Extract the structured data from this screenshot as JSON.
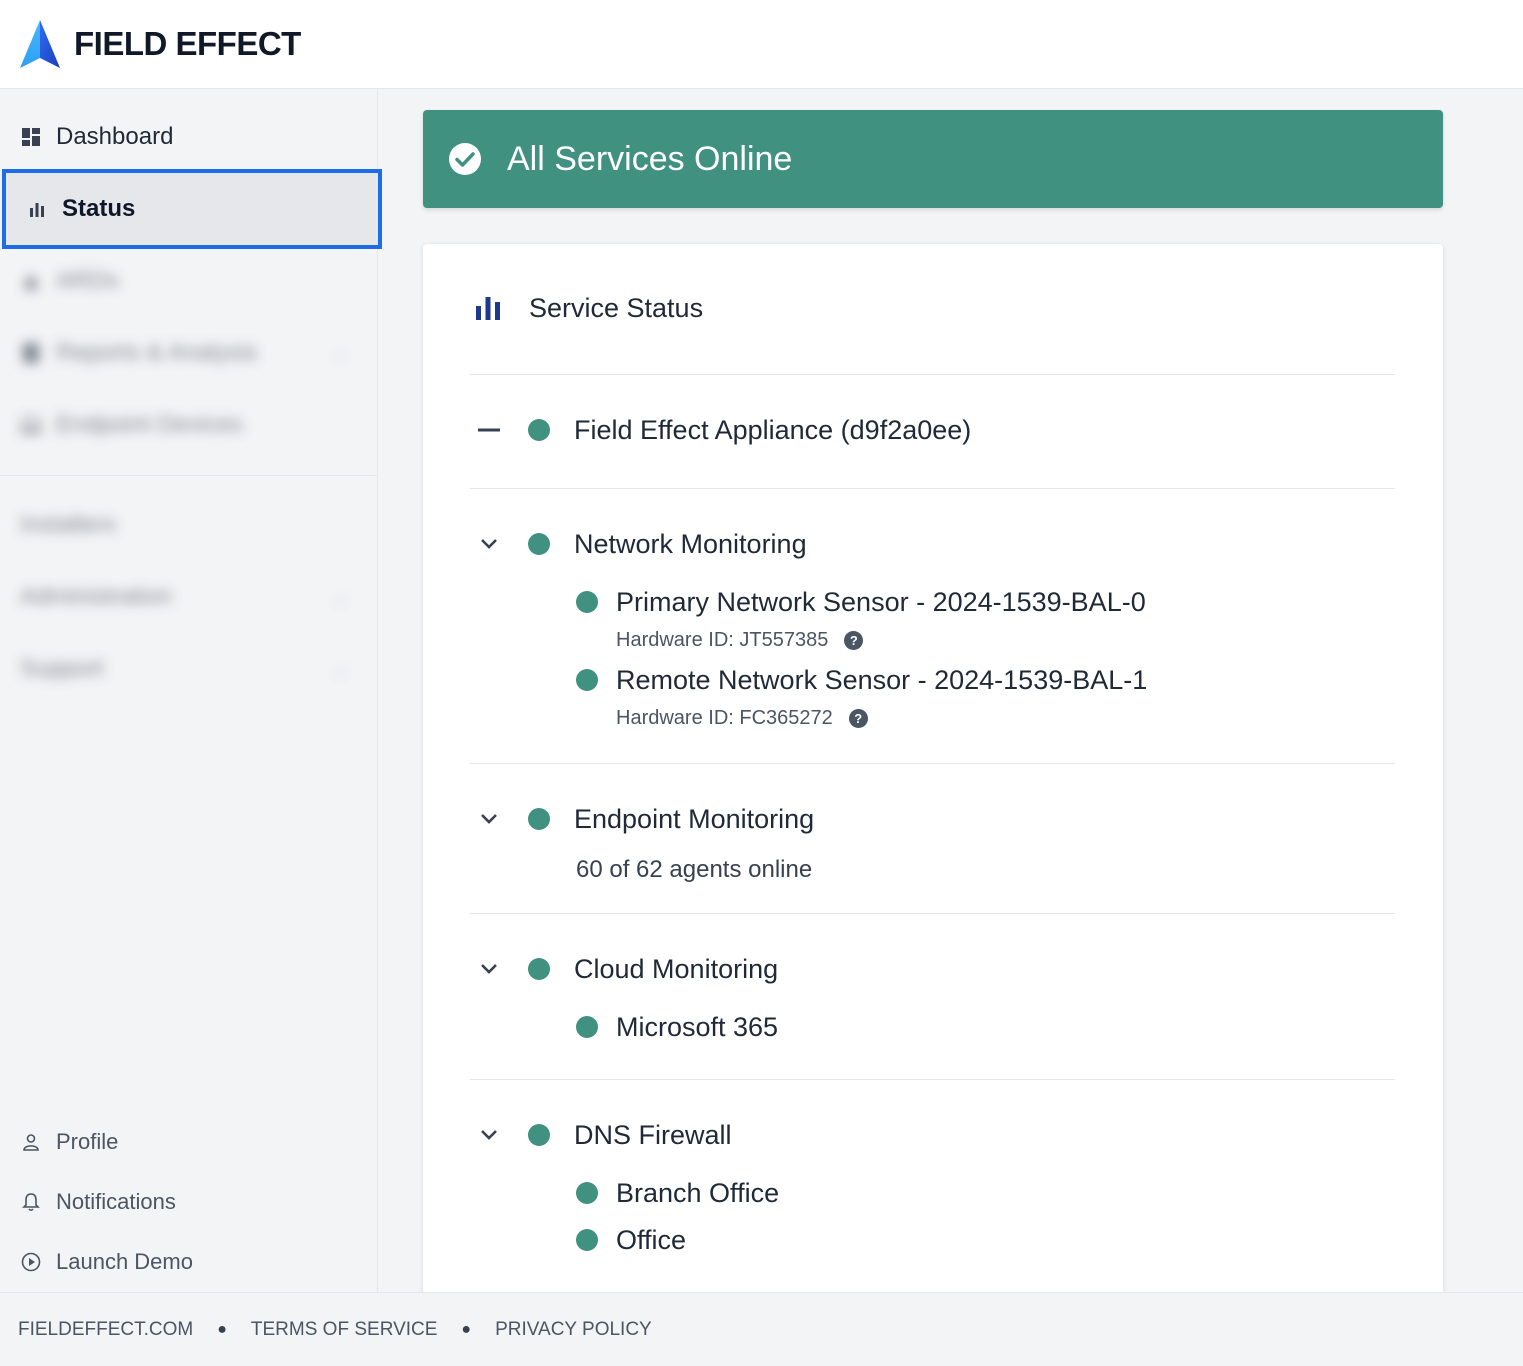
{
  "brand": {
    "name": "FIELD EFFECT"
  },
  "sidebar": {
    "items": [
      {
        "label": "Dashboard",
        "icon": "dashboard-grid-icon"
      },
      {
        "label": "Status",
        "icon": "bar-chart-icon",
        "active": true
      },
      {
        "label": "ARDs",
        "icon": "alert-icon"
      },
      {
        "label": "Reports & Analysis",
        "icon": "report-icon"
      },
      {
        "label": "Endpoint Devices",
        "icon": "laptop-icon"
      },
      {
        "label": "Installers"
      },
      {
        "label": "Administration"
      },
      {
        "label": "Support"
      }
    ],
    "bottom": [
      {
        "label": "Profile",
        "icon": "user-icon"
      },
      {
        "label": "Notifications",
        "icon": "bell-icon"
      },
      {
        "label": "Launch Demo",
        "icon": "play-circle-icon"
      }
    ]
  },
  "banner": {
    "text": "All Services Online",
    "color": "#419180"
  },
  "service_status": {
    "title": "Service Status",
    "services": [
      {
        "label": "Field Effect Appliance (d9f2a0ee)",
        "status": "online"
      },
      {
        "label": "Network Monitoring",
        "status": "online",
        "children": [
          {
            "label": "Primary Network Sensor - 2024-1539-BAL-0",
            "hardware_id": "Hardware ID: JT557385"
          },
          {
            "label": "Remote Network Sensor - 2024-1539-BAL-1",
            "hardware_id": "Hardware ID: FC365272"
          }
        ]
      },
      {
        "label": "Endpoint Monitoring",
        "status": "online",
        "detail": "60 of 62 agents online"
      },
      {
        "label": "Cloud Monitoring",
        "status": "online",
        "children": [
          {
            "label": "Microsoft 365"
          }
        ]
      },
      {
        "label": "DNS Firewall",
        "status": "online",
        "children": [
          {
            "label": "Branch Office"
          },
          {
            "label": "Office"
          }
        ]
      }
    ]
  },
  "footer": {
    "links": [
      "FIELDEFFECT.COM",
      "TERMS OF SERVICE",
      "PRIVACY POLICY"
    ]
  },
  "colors": {
    "accent": "#419180",
    "focus": "#1d6ce8"
  }
}
